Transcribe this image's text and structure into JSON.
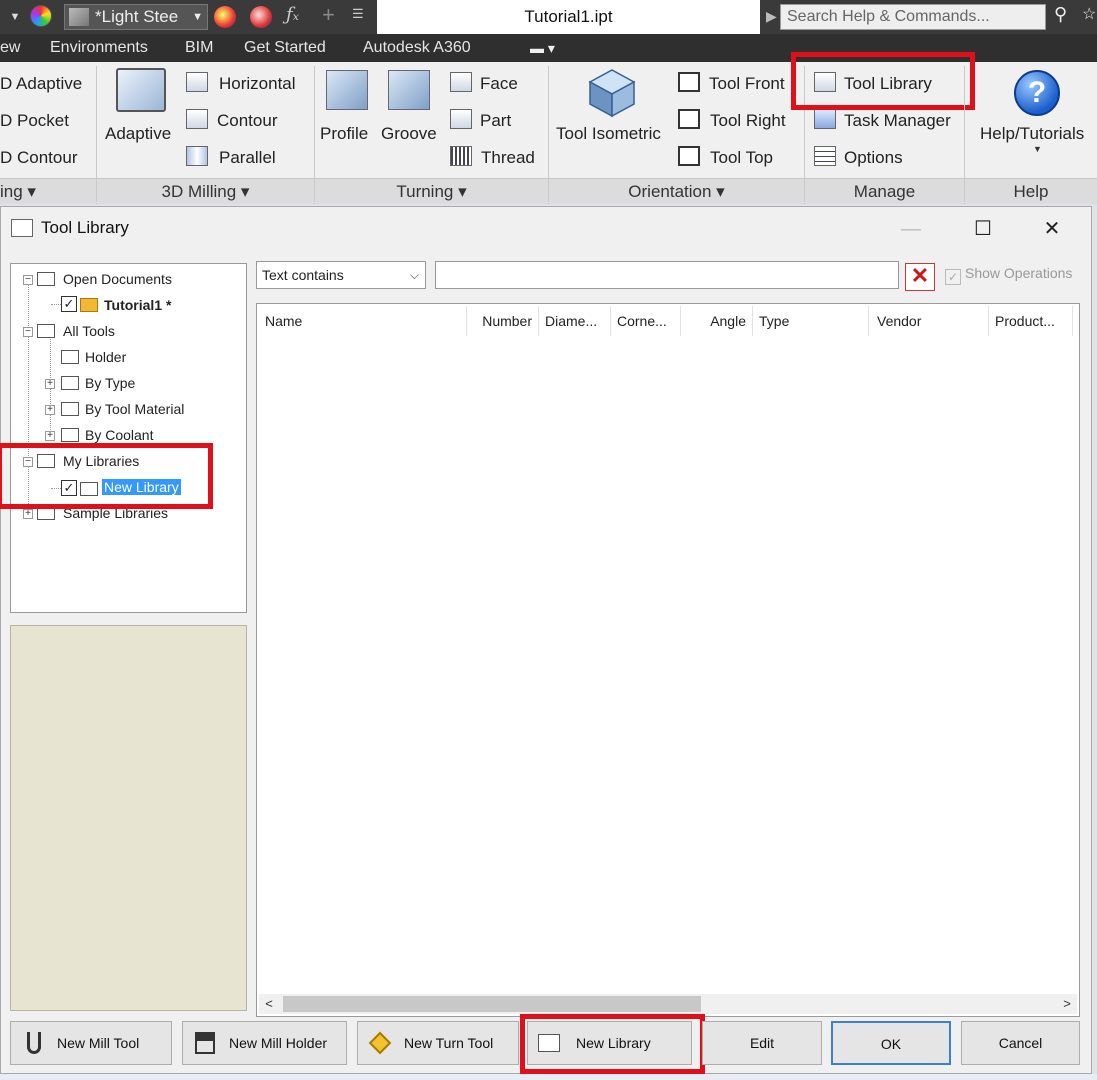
{
  "titlebar": {
    "material": "*Light Stee",
    "document_title": "Tutorial1.ipt",
    "search_placeholder": "Search Help & Commands..."
  },
  "ribbon_tabs": [
    "ew",
    "Environments",
    "BIM",
    "Get Started",
    "Autodesk A360"
  ],
  "ribbon": {
    "milling_left": [
      "D Adaptive",
      "D Pocket",
      "D Contour"
    ],
    "adaptive_label": "Adaptive",
    "milling_right": [
      "Horizontal",
      "Contour",
      "Parallel"
    ],
    "profile_label": "Profile",
    "groove_label": "Groove",
    "turning_items": [
      "Face",
      "Part",
      "Thread"
    ],
    "tool_isometric": "Tool Isometric",
    "orientation_items": [
      "Tool Front",
      "Tool Right",
      "Tool Top"
    ],
    "manage_items": [
      "Tool Library",
      "Task Manager",
      "Options"
    ],
    "help_label": "Help/Tutorials",
    "groups": {
      "left": "ing",
      "milling_3d": "3D Milling",
      "turning": "Turning",
      "orientation": "Orientation",
      "manage": "Manage",
      "help": "Help"
    }
  },
  "dialog": {
    "title": "Tool Library",
    "tree": {
      "open_documents": "Open Documents",
      "tutorial": "Tutorial1 *",
      "all_tools": "All Tools",
      "holder": "Holder",
      "by_type": "By Type",
      "by_tool_material": "By Tool Material",
      "by_coolant": "By Coolant",
      "my_libraries": "My Libraries",
      "new_library": "New Library",
      "sample_libraries": "Sample Libraries"
    },
    "filter_mode": "Text contains",
    "filter_value": "",
    "show_operations": "Show Operations",
    "columns": [
      "Name",
      "Number",
      "Diame...",
      "Corne...",
      "Angle",
      "Type",
      "Vendor",
      "Product..."
    ],
    "buttons": {
      "new_mill_tool": "New Mill Tool",
      "new_mill_holder": "New Mill Holder",
      "new_turn_tool": "New Turn Tool",
      "new_library": "New Library",
      "edit": "Edit",
      "ok": "OK",
      "cancel": "Cancel"
    }
  },
  "colors": {
    "highlight": "#e0101a",
    "selection": "#3399ff",
    "ribbon_tabs_bg": "#2f2f2f"
  }
}
